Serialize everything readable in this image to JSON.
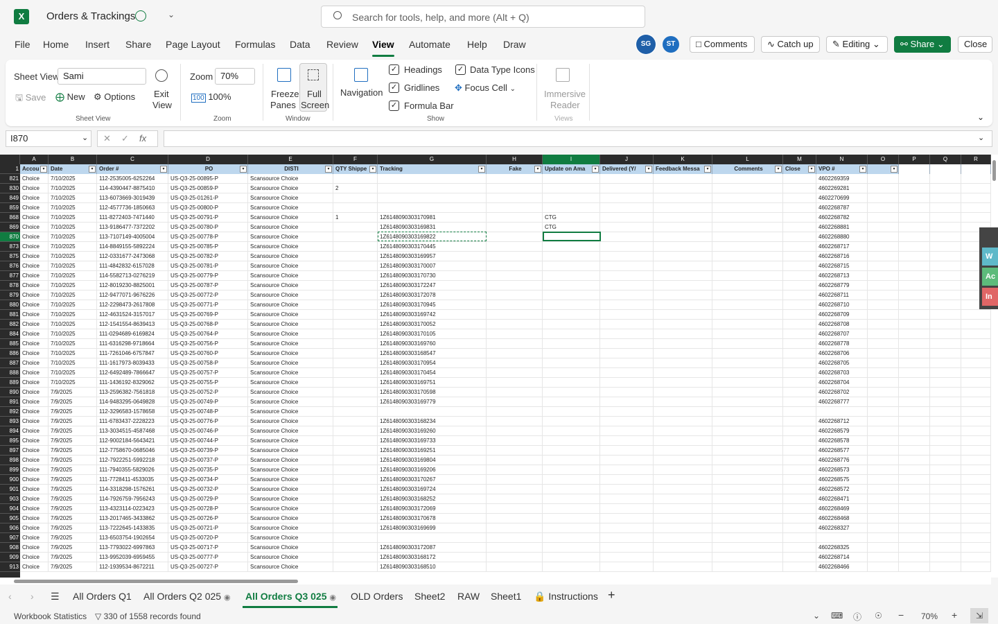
{
  "app": {
    "doc_title": "Orders & Trackings",
    "search_placeholder": "Search for tools, help, and more (Alt + Q)"
  },
  "menu": [
    "File",
    "Home",
    "Insert",
    "Share",
    "Page Layout",
    "Formulas",
    "Data",
    "Review",
    "View",
    "Automate",
    "Help",
    "Draw"
  ],
  "active_menu": "View",
  "top_buttons": {
    "avatar1": "SG",
    "avatar2": "ST",
    "comments": "Comments",
    "catch_up": "Catch up",
    "editing": "Editing",
    "share": "Share",
    "close": "Close"
  },
  "ribbon": {
    "sheet_view_label": "Sheet View",
    "sheet_view_value": "Sami",
    "save": "Save",
    "new": "New",
    "options": "Options",
    "exit_view": "Exit View",
    "exit_view_l1": "Exit",
    "exit_view_l2": "View",
    "sheet_view_group": "Sheet View",
    "zoom_label": "Zoom",
    "zoom_value": "70%",
    "zoom_100": "100%",
    "zoom_group": "Zoom",
    "freeze_l1": "Freeze",
    "freeze_l2": "Panes",
    "fullscreen_l1": "Full",
    "fullscreen_l2": "Screen",
    "window_group": "Window",
    "navigation": "Navigation",
    "headings": "Headings",
    "gridlines": "Gridlines",
    "formula_bar": "Formula Bar",
    "data_type_icons": "Data Type Icons",
    "focus_cell": "Focus Cell",
    "show_group": "Show",
    "immersive_l1": "Immersive",
    "immersive_l2": "Reader",
    "views_group": "Views"
  },
  "formula_bar": {
    "name_box": "I870",
    "fx": "fx",
    "value": ""
  },
  "columns": [
    "A",
    "B",
    "C",
    "D",
    "E",
    "F",
    "G",
    "H",
    "I",
    "J",
    "K",
    "L",
    "M",
    "N",
    "O",
    "P",
    "Q",
    "R"
  ],
  "headers": [
    "Accou",
    "Date",
    "Order #",
    "PO",
    "DISTI",
    "QTY Shippe",
    "Tracking",
    "Fake",
    "Update on Ama",
    "Delivered (Y/",
    "Feedback Messa",
    "Comments",
    "Close",
    "VPO #",
    "",
    "",
    "",
    ""
  ],
  "rows": [
    [
      "821",
      "Choice",
      "7/10/2025",
      "112-2535005-6252264",
      "US-Q3-25-00895-P",
      "Scansource Choice",
      "",
      "",
      "",
      "",
      "",
      "",
      "",
      "",
      "4602269359"
    ],
    [
      "830",
      "Choice",
      "7/10/2025",
      "114-4390447-8875410",
      "US-Q3-25-00859-P",
      "Scansource Choice",
      "2",
      "",
      "",
      "",
      "",
      "",
      "",
      "",
      "4602269281"
    ],
    [
      "849",
      "Choice",
      "7/10/2025",
      "113-6073669-3019439",
      "US-Q3-25-01261-P",
      "Scansource Choice",
      "",
      "",
      "",
      "",
      "",
      "",
      "",
      "",
      "4602270699"
    ],
    [
      "859",
      "Choice",
      "7/10/2025",
      "112-4577736-1850663",
      "US-Q3-25-00800-P",
      "Scansource Choice",
      "",
      "",
      "",
      "",
      "",
      "",
      "",
      "",
      "4602268787"
    ],
    [
      "868",
      "Choice",
      "7/10/2025",
      "111-8272403-7471440",
      "US-Q3-25-00791-P",
      "Scansource Choice",
      "1",
      "1Z6148090303170981",
      "",
      "CTG",
      "",
      "",
      "",
      "",
      "4602268782"
    ],
    [
      "869",
      "Choice",
      "7/10/2025",
      "113-9186477-7372202",
      "US-Q3-25-00780-P",
      "Scansource Choice",
      "",
      "1Z6148090303169831",
      "",
      "CTG",
      "",
      "",
      "",
      "",
      "4602268881"
    ],
    [
      "870",
      "Choice",
      "7/10/2025",
      "113-7107149-4005004",
      "US-Q3-25-00778-P",
      "Scansource Choice",
      "",
      "1Z6148090303169822",
      "",
      "",
      "",
      "",
      "",
      "",
      "4602268880"
    ],
    [
      "873",
      "Choice",
      "7/10/2025",
      "114-8849155-5892224",
      "US-Q3-25-00785-P",
      "Scansource Choice",
      "",
      "1Z6148090303170445",
      "",
      "",
      "",
      "",
      "",
      "",
      "4602268717"
    ],
    [
      "875",
      "Choice",
      "7/10/2025",
      "112-0331677-2473068",
      "US-Q3-25-00782-P",
      "Scansource Choice",
      "",
      "1Z6148090303169957",
      "",
      "",
      "",
      "",
      "",
      "",
      "4602268716"
    ],
    [
      "876",
      "Choice",
      "7/10/2025",
      "111-4842832-6157028",
      "US-Q3-25-00781-P",
      "Scansource Choice",
      "",
      "1Z6148090303170007",
      "",
      "",
      "",
      "",
      "",
      "",
      "4602268715"
    ],
    [
      "877",
      "Choice",
      "7/10/2025",
      "114-5582713-0276219",
      "US-Q3-25-00779-P",
      "Scansource Choice",
      "",
      "1Z6148090303170730",
      "",
      "",
      "",
      "",
      "",
      "",
      "4602268713"
    ],
    [
      "878",
      "Choice",
      "7/10/2025",
      "112-8019230-8825001",
      "US-Q3-25-00787-P",
      "Scansource Choice",
      "",
      "1Z6148090303172247",
      "",
      "",
      "",
      "",
      "",
      "",
      "4602268779"
    ],
    [
      "879",
      "Choice",
      "7/10/2025",
      "112-9477071-9676226",
      "US-Q3-25-00772-P",
      "Scansource Choice",
      "",
      "1Z6148090303172078",
      "",
      "",
      "",
      "",
      "",
      "",
      "4602268711"
    ],
    [
      "880",
      "Choice",
      "7/10/2025",
      "112-2298473-2617808",
      "US-Q3-25-00771-P",
      "Scansource Choice",
      "",
      "1Z6148090303170945",
      "",
      "",
      "",
      "",
      "",
      "",
      "4602268710"
    ],
    [
      "881",
      "Choice",
      "7/10/2025",
      "112-4631524-3157017",
      "US-Q3-25-00769-P",
      "Scansource Choice",
      "",
      "1Z6148090303169742",
      "",
      "",
      "",
      "",
      "",
      "",
      "4602268709"
    ],
    [
      "882",
      "Choice",
      "7/10/2025",
      "112-1541554-8639413",
      "US-Q3-25-00768-P",
      "Scansource Choice",
      "",
      "1Z6148090303170052",
      "",
      "",
      "",
      "",
      "",
      "",
      "4602268708"
    ],
    [
      "884",
      "Choice",
      "7/10/2025",
      "111-0294689-6169824",
      "US-Q3-25-00764-P",
      "Scansource Choice",
      "",
      "1Z6148090303170105",
      "",
      "",
      "",
      "",
      "",
      "",
      "4602268707"
    ],
    [
      "885",
      "Choice",
      "7/10/2025",
      "111-6316298-9718664",
      "US-Q3-25-00756-P",
      "Scansource Choice",
      "",
      "1Z6148090303169760",
      "",
      "",
      "",
      "",
      "",
      "",
      "4602268778"
    ],
    [
      "886",
      "Choice",
      "7/10/2025",
      "111-7261046-6757847",
      "US-Q3-25-00760-P",
      "Scansource Choice",
      "",
      "1Z6148090303168547",
      "",
      "",
      "",
      "",
      "",
      "",
      "4602268706"
    ],
    [
      "887",
      "Choice",
      "7/10/2025",
      "111-1617973-8039433",
      "US-Q3-25-00758-P",
      "Scansource Choice",
      "",
      "1Z6148090303170954",
      "",
      "",
      "",
      "",
      "",
      "",
      "4602268705"
    ],
    [
      "888",
      "Choice",
      "7/10/2025",
      "112-6492489-7866647",
      "US-Q3-25-00757-P",
      "Scansource Choice",
      "",
      "1Z6148090303170454",
      "",
      "",
      "",
      "",
      "",
      "",
      "4602268703"
    ],
    [
      "889",
      "Choice",
      "7/10/2025",
      "111-1436192-8329062",
      "US-Q3-25-00755-P",
      "Scansource Choice",
      "",
      "1Z6148090303169751",
      "",
      "",
      "",
      "",
      "",
      "",
      "4602268704"
    ],
    [
      "890",
      "Choice",
      "7/9/2025",
      "113-2596382-7561818",
      "US-Q3-25-00752-P",
      "Scansource Choice",
      "",
      "1Z6148090303170598",
      "",
      "",
      "",
      "",
      "",
      "",
      "4602268702"
    ],
    [
      "891",
      "Choice",
      "7/9/2025",
      "114-9483295-0649828",
      "US-Q3-25-00749-P",
      "Scansource Choice",
      "",
      "1Z6148090303169779",
      "",
      "",
      "",
      "",
      "",
      "",
      "4602268777"
    ],
    [
      "892",
      "Choice",
      "7/9/2025",
      "112-3296583-1578658",
      "US-Q3-25-00748-P",
      "Scansource Choice",
      "",
      "",
      "",
      "",
      "",
      "",
      "",
      "",
      ""
    ],
    [
      "893",
      "Choice",
      "7/9/2025",
      "111-6783437-2228223",
      "US-Q3-25-00776-P",
      "Scansource Choice",
      "",
      "1Z6148090303168234",
      "",
      "",
      "",
      "",
      "",
      "",
      "4602268712"
    ],
    [
      "894",
      "Choice",
      "7/9/2025",
      "113-3034515-4587468",
      "US-Q3-25-00746-P",
      "Scansource Choice",
      "",
      "1Z6148090303169260",
      "",
      "",
      "",
      "",
      "",
      "",
      "4602268579"
    ],
    [
      "895",
      "Choice",
      "7/9/2025",
      "112-9002184-5643421",
      "US-Q3-25-00744-P",
      "Scansource Choice",
      "",
      "1Z6148090303169733",
      "",
      "",
      "",
      "",
      "",
      "",
      "4602268578"
    ],
    [
      "897",
      "Choice",
      "7/9/2025",
      "112-7758670-0685046",
      "US-Q3-25-00739-P",
      "Scansource Choice",
      "",
      "1Z6148090303169251",
      "",
      "",
      "",
      "",
      "",
      "",
      "4602268577"
    ],
    [
      "898",
      "Choice",
      "7/9/2025",
      "112-7922251-5992218",
      "US-Q3-25-00737-P",
      "Scansource Choice",
      "",
      "1Z6148090303169804",
      "",
      "",
      "",
      "",
      "",
      "",
      "4602268776"
    ],
    [
      "899",
      "Choice",
      "7/9/2025",
      "111-7940355-5829026",
      "US-Q3-25-00735-P",
      "Scansource Choice",
      "",
      "1Z6148090303169206",
      "",
      "",
      "",
      "",
      "",
      "",
      "4602268573"
    ],
    [
      "900",
      "Choice",
      "7/9/2025",
      "111-7728411-4533035",
      "US-Q3-25-00734-P",
      "Scansource Choice",
      "",
      "1Z6148090303170267",
      "",
      "",
      "",
      "",
      "",
      "",
      "4602268575"
    ],
    [
      "901",
      "Choice",
      "7/9/2025",
      "114-3318298-1576261",
      "US-Q3-25-00732-P",
      "Scansource Choice",
      "",
      "1Z6148090303169724",
      "",
      "",
      "",
      "",
      "",
      "",
      "4602268572"
    ],
    [
      "903",
      "Choice",
      "7/9/2025",
      "114-7926759-7956243",
      "US-Q3-25-00729-P",
      "Scansource Choice",
      "",
      "1Z6148090303168252",
      "",
      "",
      "",
      "",
      "",
      "",
      "4602268471"
    ],
    [
      "904",
      "Choice",
      "7/9/2025",
      "113-4323114-0223423",
      "US-Q3-25-00728-P",
      "Scansource Choice",
      "",
      "1Z6148090303172069",
      "",
      "",
      "",
      "",
      "",
      "",
      "4602268469"
    ],
    [
      "905",
      "Choice",
      "7/9/2025",
      "113-2017465-3433862",
      "US-Q3-25-00726-P",
      "Scansource Choice",
      "",
      "1Z6148090303170678",
      "",
      "",
      "",
      "",
      "",
      "",
      "4602268468"
    ],
    [
      "906",
      "Choice",
      "7/9/2025",
      "113-7222645-1433835",
      "US-Q3-25-00721-P",
      "Scansource Choice",
      "",
      "1Z6148090303169699",
      "",
      "",
      "",
      "",
      "",
      "",
      "4602268327"
    ],
    [
      "907",
      "Choice",
      "7/9/2025",
      "113-6503754-1902654",
      "US-Q3-25-00720-P",
      "Scansource Choice",
      "",
      "",
      "",
      "",
      "",
      "",
      "",
      "",
      ""
    ],
    [
      "908",
      "Choice",
      "7/9/2025",
      "113-7793022-6997863",
      "US-Q3-25-00717-P",
      "Scansource Choice",
      "",
      "1Z6148090303172087",
      "",
      "",
      "",
      "",
      "",
      "",
      "4602268325"
    ],
    [
      "909",
      "Choice",
      "7/9/2025",
      "113-9952039-6959455",
      "US-Q3-25-00777-P",
      "Scansource Choice",
      "",
      "1Z6148090303168172",
      "",
      "",
      "",
      "",
      "",
      "",
      "4602268714"
    ],
    [
      "913",
      "Choice",
      "7/9/2025",
      "112-1939534-8672211",
      "US-Q3-25-00727-P",
      "Scansource Choice",
      "",
      "1Z6148090303168510",
      "",
      "",
      "",
      "",
      "",
      "",
      "4602268466"
    ]
  ],
  "side_panel": [
    "W",
    "Ac",
    "In"
  ],
  "side_colors": [
    "#5fb9c9",
    "#5dbb7b",
    "#e06666"
  ],
  "tabs": [
    "All Orders Q1",
    "All Orders Q2 025",
    "All Orders Q3 025",
    "OLD Orders",
    "Sheet2",
    "RAW",
    "Sheet1",
    "Instructions"
  ],
  "active_tab": "All Orders Q3 025",
  "status": {
    "workbook_statistics": "Workbook Statistics",
    "records": "330 of 1558 records found",
    "zoom": "70%"
  },
  "colors": {
    "accent": "#107c41",
    "header_fill": "#bdd7ee",
    "dark_header": "#2b2b2b"
  }
}
